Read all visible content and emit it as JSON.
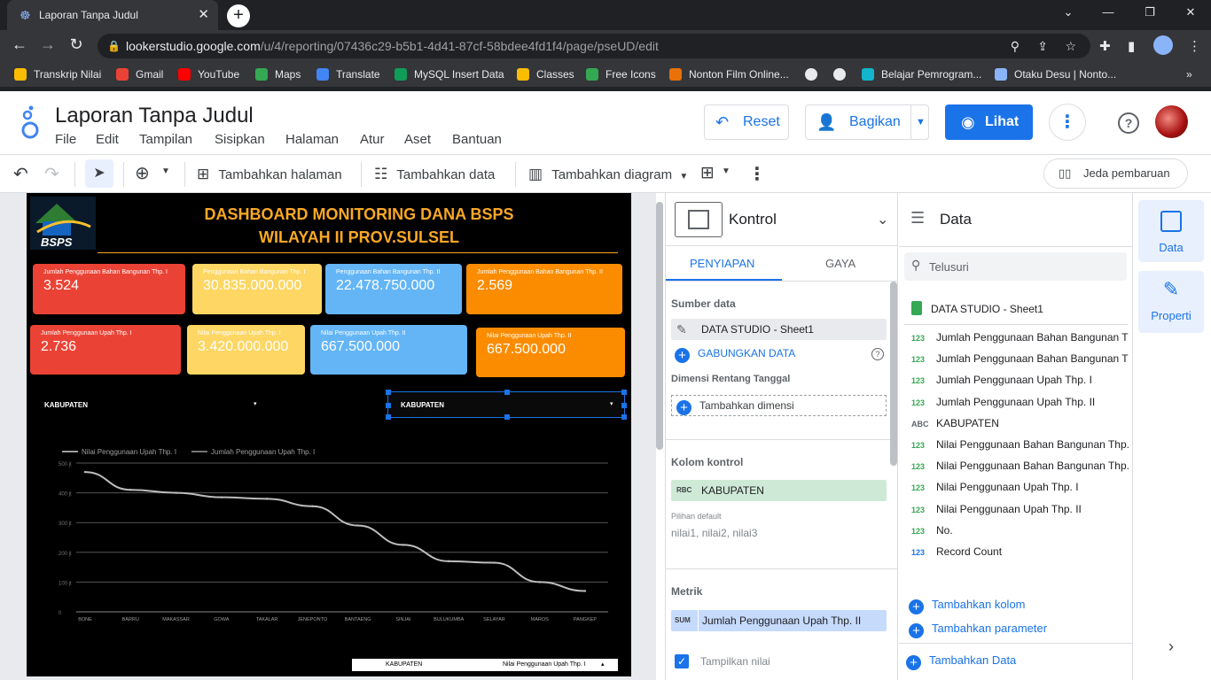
{
  "browser": {
    "tab_title": "Laporan Tanpa Judul",
    "url_domain": "lookerstudio.google.com",
    "url_path": "/u/4/reporting/07436c29-b5b1-4d41-87cf-58bdee4fd1f4/page/pseUD/edit",
    "bookmarks": [
      {
        "label": "Transkrip Nilai",
        "color": "#fbbc04"
      },
      {
        "label": "Gmail",
        "color": "#ea4335"
      },
      {
        "label": "YouTube",
        "color": "#ff0000"
      },
      {
        "label": "Maps",
        "color": "#34a853"
      },
      {
        "label": "Translate",
        "color": "#4285f4"
      },
      {
        "label": "MySQL Insert Data",
        "color": "#0f9d58"
      },
      {
        "label": "Classes",
        "color": "#fbbc04"
      },
      {
        "label": "Free Icons",
        "color": "#34a853"
      },
      {
        "label": "Nonton Film Online...",
        "color": "#e8710a"
      },
      {
        "label": "",
        "color": "#e8eaed"
      },
      {
        "label": "",
        "color": "#e8eaed"
      },
      {
        "label": "Belajar Pemrogram...",
        "color": "#12b5cb"
      },
      {
        "label": "Otaku Desu | Nonto...",
        "color": "#8ab4f8"
      }
    ]
  },
  "app": {
    "report_title": "Laporan Tanpa Judul",
    "menus": [
      "File",
      "Edit",
      "Tampilan",
      "Sisipkan",
      "Halaman",
      "Atur",
      "Aset",
      "Bantuan"
    ],
    "reset_label": "Reset",
    "share_label": "Bagikan",
    "view_label": "Lihat"
  },
  "toolbar": {
    "add_page": "Tambahkan halaman",
    "add_data": "Tambahkan data",
    "add_chart": "Tambahkan diagram",
    "pause_updates": "Jeda pembaruan"
  },
  "dashboard": {
    "title_line1": "DASHBOARD MONITORING DANA BSPS",
    "title_line2": "WILAYAH II PROV.SULSEL",
    "logo_text": "BSPS",
    "kpis_row1": [
      {
        "label": "Jumlah Penggunaan Bahan Bangunan Thp. I",
        "value": "3.524",
        "color": "#ea4335"
      },
      {
        "label": "Penggunaan Bahan Bangunan Thp. I",
        "value": "30.835.000.000",
        "color": "#fdd663"
      },
      {
        "label": "Penggunaan Bahan Bangunan Thp. II",
        "value": "22.478.750.000",
        "color": "#64b5f6"
      },
      {
        "label": "Jumlah Penggunaan Bahan Bangunan Thp. II",
        "value": "2.569",
        "color": "#fb8c00"
      }
    ],
    "kpis_row2": [
      {
        "label": "Jumlah Penggunaan Upah Thp. I",
        "value": "2.736",
        "color": "#ea4335"
      },
      {
        "label": "Nilai Penggunaan Upah Thp. I",
        "value": "3.420.000.000",
        "color": "#fdd663"
      },
      {
        "label": "Nilai Penggunaan Upah Thp. II",
        "value": "667.500.000",
        "color": "#64b5f6"
      },
      {
        "label": "Nilai Penggunaan Upah Thp. II",
        "value": "667.500.000",
        "color": "#fb8c00"
      }
    ],
    "filter1": "KABUPATEN",
    "filter2": "KABUPATEN",
    "table_header": {
      "col1": "KABUPATEN",
      "col2": "Nilai Penggunaan Upah Thp. I"
    }
  },
  "chart_data": {
    "type": "line",
    "categories": [
      "BONE",
      "BARRU",
      "MAKASSAR",
      "GOWA",
      "TAKALAR",
      "JENEPONTO",
      "BANTAENG",
      "SINJAI",
      "BULUKUMBA",
      "SELAYAR",
      "MAROS",
      "PANGKEP"
    ],
    "series": [
      {
        "name": "Nilai Penggunaan Upah Thp. I",
        "values": [
          470,
          410,
          400,
          385,
          380,
          355,
          290,
          225,
          170,
          165,
          100,
          70
        ]
      },
      {
        "name": "Jumlah Penggunaan Upah Thp. I",
        "values": []
      }
    ],
    "yticks": [
      "0",
      "100 jt",
      "200 jt",
      "300 jt",
      "400 jt",
      "500 jt"
    ],
    "ylim": [
      0,
      500
    ],
    "ylabel_unit": "jt",
    "grid": true,
    "legend": "top-left"
  },
  "properties": {
    "panel_title": "Kontrol",
    "tab_setup": "PENYIAPAN",
    "tab_style": "GAYA",
    "data_source_title": "Sumber data",
    "data_source": "DATA STUDIO - Sheet1",
    "blend_data": "GABUNGKAN DATA",
    "date_range_title": "Dimensi Rentang Tanggal",
    "add_dimension": "Tambahkan dimensi",
    "control_field_title": "Kolom kontrol",
    "control_field": "KABUPATEN",
    "default_label": "Pilihan default",
    "default_value": "nilai1, nilai2, nilai3",
    "metric_title": "Metrik",
    "metric_agg": "SUM",
    "metric_field": "Jumlah Penggunaan Upah Thp. II",
    "show_value": "Tampilkan nilai"
  },
  "data_panel": {
    "title": "Data",
    "search_placeholder": "Telusuri",
    "source": "DATA STUDIO - Sheet1",
    "fields": [
      {
        "type": "123",
        "name": "Jumlah Penggunaan Bahan Bangunan Thp. I"
      },
      {
        "type": "123",
        "name": "Jumlah Penggunaan Bahan Bangunan Thp. II"
      },
      {
        "type": "123",
        "name": "Jumlah Penggunaan Upah Thp. I"
      },
      {
        "type": "123",
        "name": "Jumlah Penggunaan Upah Thp. II"
      },
      {
        "type": "ABC",
        "name": "KABUPATEN"
      },
      {
        "type": "123",
        "name": "Nilai Penggunaan Bahan Bangunan Thp. I"
      },
      {
        "type": "123",
        "name": "Nilai Penggunaan Bahan Bangunan Thp. II"
      },
      {
        "type": "123",
        "name": "Nilai Penggunaan Upah Thp. I"
      },
      {
        "type": "123",
        "name": "Nilai Penggunaan Upah Thp. II"
      },
      {
        "type": "123",
        "name": "No."
      },
      {
        "type": "123",
        "name": "Record Count"
      }
    ],
    "add_field": "Tambahkan kolom",
    "add_param": "Tambahkan parameter",
    "add_data": "Tambahkan Data"
  },
  "side_tabs": {
    "data": "Data",
    "properties": "Properti"
  }
}
